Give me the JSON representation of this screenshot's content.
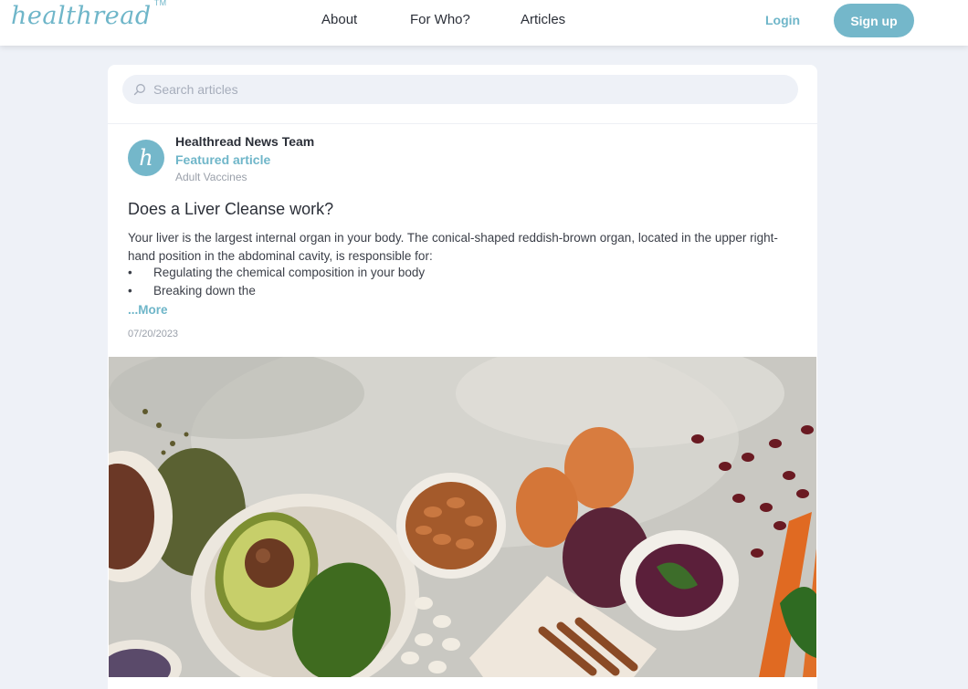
{
  "header": {
    "logo": "healthread",
    "logo_mark": "TM",
    "nav": [
      {
        "label": "About"
      },
      {
        "label": "For Who?"
      },
      {
        "label": "Articles"
      }
    ],
    "login_label": "Login",
    "signup_label": "Sign up"
  },
  "search": {
    "placeholder": "Search articles",
    "icon": "search-icon"
  },
  "post": {
    "avatar_letter": "h",
    "author": "Healthread News Team",
    "badge": "Featured article",
    "category": "Adult Vaccines",
    "title": "Does a Liver Cleanse work?",
    "excerpt": "Your liver is the largest internal organ in your body. The conical-shaped reddish-brown organ, located in the upper right-hand position in the abdominal cavity, is responsible for:",
    "bullets": [
      "Regulating the chemical composition in your body",
      "Breaking down the"
    ],
    "bullet_symbol": "•",
    "more_label": "...More",
    "date": "07/20/2023"
  },
  "colors": {
    "accent": "#74b7ca",
    "background": "#eef1f7",
    "text": "#2b2f38"
  }
}
